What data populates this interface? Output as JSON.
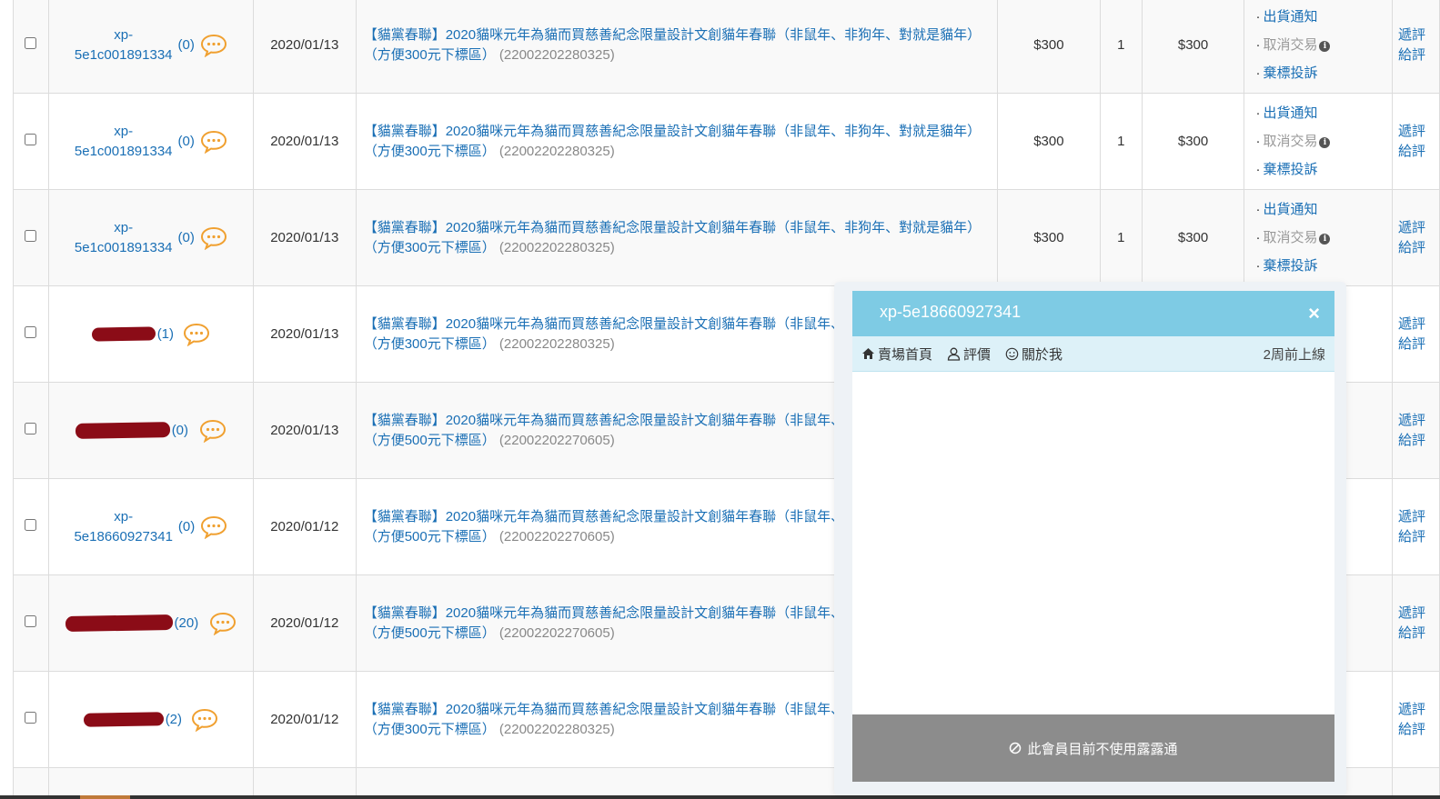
{
  "colors": {
    "link": "#1a6fb5",
    "chat_icon": "#f0a030",
    "popup_header": "#7ecbe4",
    "popup_nav": "#ddf1f8",
    "popup_footer": "#8c8c8c",
    "redaction": "#8b0c17"
  },
  "rows": [
    {
      "buyer_id_line1": "xp-",
      "buyer_id_line2": "5e1c001891334",
      "buyer_count": "(0)",
      "date": "2020/01/13",
      "title": "【貓黨春聯】2020貓咪元年為貓而買慈善紀念限量設計文創貓年春聯（非鼠年、非狗年、對就是貓年）（方便300元下標區）",
      "code": "(22002202280325)",
      "price": "$300",
      "qty": "1",
      "total": "$300",
      "action_ship": "出貨通知",
      "action_cancel": "取消交易",
      "action_complain": "棄標投訴",
      "rate_line1": "遞評",
      "rate_line2": "給評"
    },
    {
      "buyer_id_line1": "xp-",
      "buyer_id_line2": "5e1c001891334",
      "buyer_count": "(0)",
      "date": "2020/01/13",
      "title": "【貓黨春聯】2020貓咪元年為貓而買慈善紀念限量設計文創貓年春聯（非鼠年、非狗年、對就是貓年）（方便300元下標區）",
      "code": "(22002202280325)",
      "price": "$300",
      "qty": "1",
      "total": "$300",
      "action_ship": "出貨通知",
      "action_cancel": "取消交易",
      "action_complain": "棄標投訴",
      "rate_line1": "遞評",
      "rate_line2": "給評"
    },
    {
      "buyer_id_line1": "xp-",
      "buyer_id_line2": "5e1c001891334",
      "buyer_count": "(0)",
      "date": "2020/01/13",
      "title": "【貓黨春聯】2020貓咪元年為貓而買慈善紀念限量設計文創貓年春聯（非鼠年、非狗年、對就是貓年）（方便300元下標區）",
      "code": "(22002202280325)",
      "price": "$300",
      "qty": "1",
      "total": "$300",
      "action_ship": "出貨通知",
      "action_cancel": "取消交易",
      "action_complain": "棄標投訴",
      "rate_line1": "遞評",
      "rate_line2": "給評"
    },
    {
      "buyer_count": "(1)",
      "date": "2020/01/13",
      "title": "【貓黨春聯】2020貓咪元年為貓而買慈善紀念限量設計文創貓年春聯（非鼠年、非狗年、對就是貓年）（方便300元下標區）",
      "code": "(22002202280325)",
      "rate_line1": "遞評",
      "rate_line2": "給評"
    },
    {
      "buyer_count": "(0)",
      "date": "2020/01/13",
      "title": "【貓黨春聯】2020貓咪元年為貓而買慈善紀念限量設計文創貓年春聯（非鼠年、非狗年、對就是貓年）（方便500元下標區）",
      "code": "(22002202270605)",
      "rate_line1": "遞評",
      "rate_line2": "給評"
    },
    {
      "buyer_id_line1": "xp-",
      "buyer_id_line2": "5e18660927341",
      "buyer_count": "(0)",
      "date": "2020/01/12",
      "title": "【貓黨春聯】2020貓咪元年為貓而買慈善紀念限量設計文創貓年春聯（非鼠年、非狗年、對就是貓年）（方便500元下標區）",
      "code": "(22002202270605)",
      "rate_line1": "遞評",
      "rate_line2": "給評"
    },
    {
      "buyer_count": "(20)",
      "date": "2020/01/12",
      "title": "【貓黨春聯】2020貓咪元年為貓而買慈善紀念限量設計文創貓年春聯（非鼠年、非狗年、對就是貓年）（方便500元下標區）",
      "code": "(22002202270605)",
      "rate_line1": "遞評",
      "rate_line2": "給評"
    },
    {
      "buyer_count": "(2)",
      "date": "2020/01/12",
      "title": "【貓黨春聯】2020貓咪元年為貓而買慈善紀念限量設計文創貓年春聯（非鼠年、非狗年、對就是貓年）（方便300元下標區）",
      "code": "(22002202280325)",
      "rate_line1": "遞評",
      "rate_line2": "給評"
    }
  ],
  "popup": {
    "title": "xp-5e18660927341",
    "close_label": "×",
    "nav_store": "賣場首頁",
    "nav_rating": "評價",
    "nav_about": "關於我",
    "last_online": "2周前上線",
    "footer_text": "此會員目前不使用露露通"
  }
}
